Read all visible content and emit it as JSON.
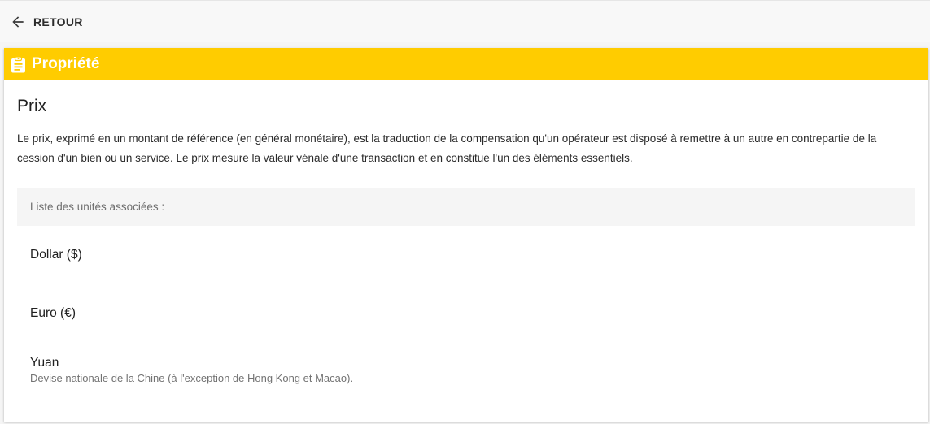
{
  "topbar": {
    "back_label": "RETOUR"
  },
  "card": {
    "header_title": "Propriété",
    "header_icon": "clipboard-icon",
    "accent_color": "#ffcc00",
    "title": "Prix",
    "description": "Le prix, exprimé en un montant de référence (en général monétaire), est la traduction de la compensation qu'un opérateur est disposé à remettre à un autre en contrepartie de la cession d'un bien ou un service. Le prix mesure la valeur vénale d'une transaction et en constitue l'un des éléments essentiels.",
    "units_label": "Liste des unités associées :",
    "units": [
      {
        "name": "Dollar ($)",
        "description": ""
      },
      {
        "name": "Euro (€)",
        "description": ""
      },
      {
        "name": "Yuan",
        "description": "Devise nationale de la Chine (à l'exception de Hong Kong et Macao)."
      }
    ]
  }
}
